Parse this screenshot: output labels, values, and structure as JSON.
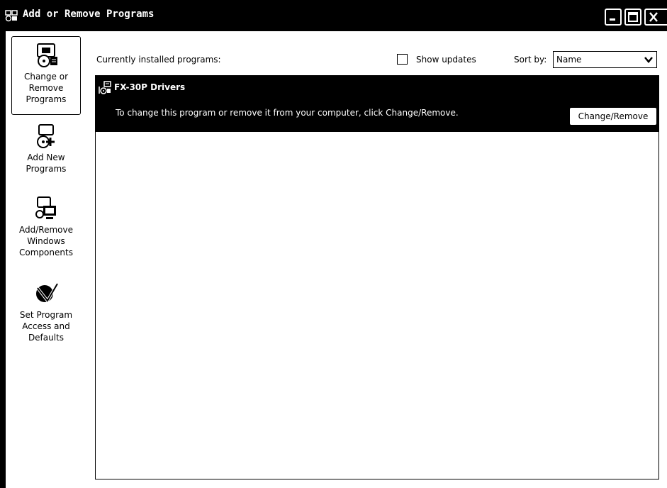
{
  "window": {
    "title": "Add or Remove Programs",
    "title_icon": "add-remove-programs-icon",
    "controls": [
      "minimize",
      "maximize",
      "close"
    ]
  },
  "sidebar": {
    "items": [
      {
        "label": "Change or\nRemove\nPrograms",
        "icon": "change-remove-programs-icon",
        "selected": true
      },
      {
        "label": "Add New\nPrograms",
        "icon": "add-new-programs-icon",
        "selected": false
      },
      {
        "label": "Add/Remove\nWindows\nComponents",
        "icon": "windows-components-icon",
        "selected": false
      },
      {
        "label": "Set Program\nAccess and\nDefaults",
        "icon": "program-access-defaults-icon",
        "selected": false
      }
    ]
  },
  "header": {
    "installed_label": "Currently installed programs:",
    "show_updates_label": "Show updates",
    "show_updates_checked": false,
    "sort_label": "Sort by:",
    "sort_value": "Name"
  },
  "programs": [
    {
      "name": "FX-30P Drivers",
      "icon": "program-icon",
      "description": "To change this program or remove it from your computer, click Change/Remove.",
      "button_label": "Change/Remove"
    }
  ],
  "colors": {
    "titlebar": "#000000",
    "selected_row": "#000000",
    "background": "#ffffff"
  }
}
